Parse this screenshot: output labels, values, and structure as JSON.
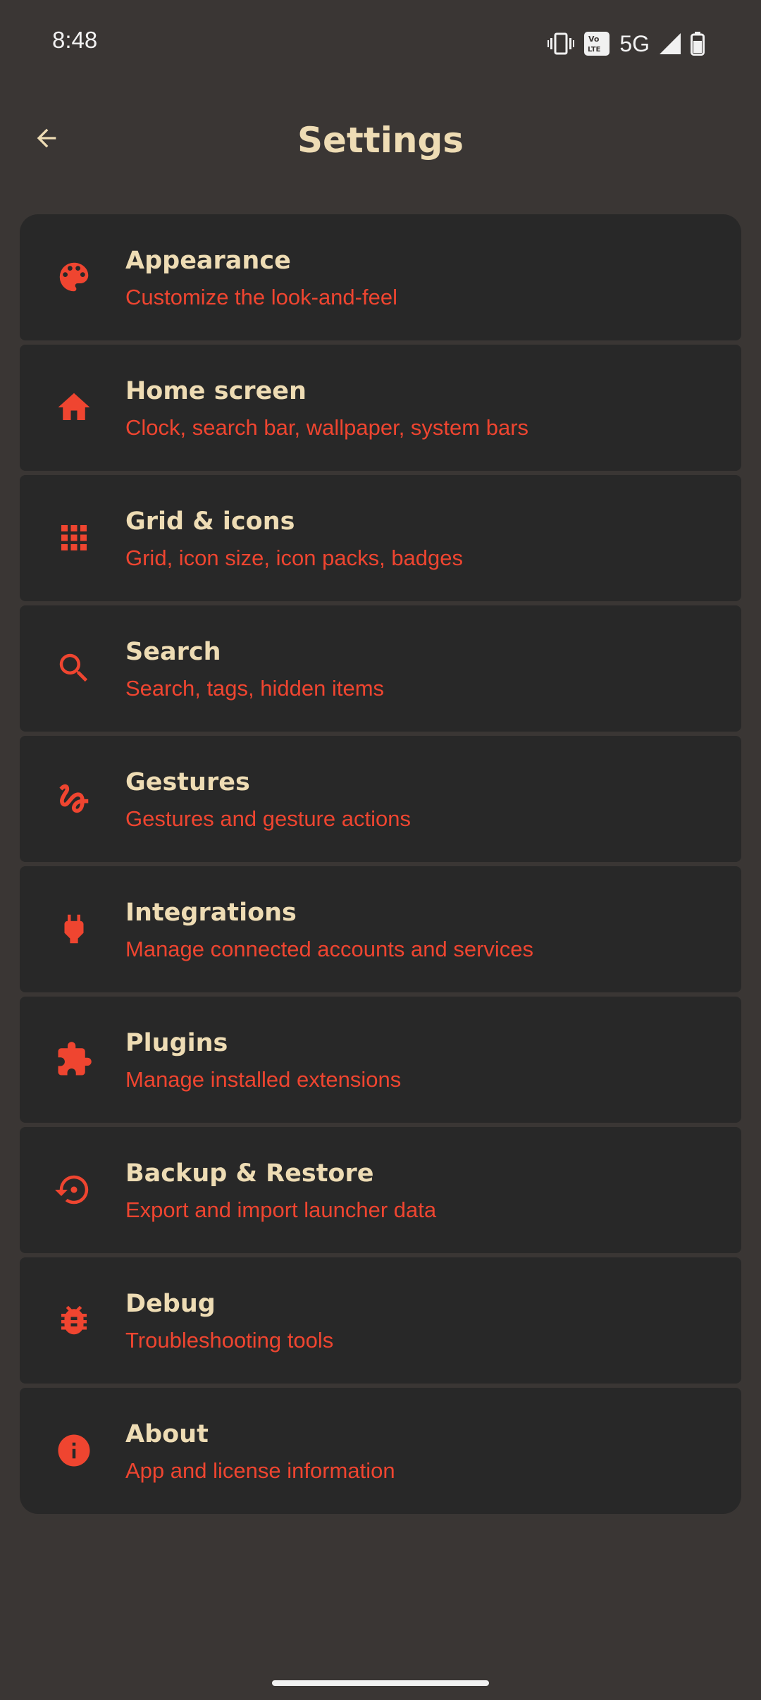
{
  "status_bar": {
    "time": "8:48",
    "network": "5G",
    "icons": [
      "vibrate-icon",
      "volte-icon",
      "signal-icon",
      "battery-icon"
    ]
  },
  "app_bar": {
    "title": "Settings",
    "back_icon": "arrow-back-icon"
  },
  "colors": {
    "background": "#3a3634",
    "card": "#282828",
    "title_text": "#eedcb4",
    "accent": "#ef4530"
  },
  "settings": [
    {
      "title": "Appearance",
      "subtitle": "Customize the look-and-feel",
      "icon": "palette-icon"
    },
    {
      "title": "Home screen",
      "subtitle": "Clock, search bar, wallpaper, system bars",
      "icon": "home-icon"
    },
    {
      "title": "Grid & icons",
      "subtitle": "Grid, icon size, icon packs, badges",
      "icon": "apps-grid-icon"
    },
    {
      "title": "Search",
      "subtitle": "Search, tags, hidden items",
      "icon": "search-icon"
    },
    {
      "title": "Gestures",
      "subtitle": "Gestures and gesture actions",
      "icon": "gesture-icon"
    },
    {
      "title": "Integrations",
      "subtitle": "Manage connected accounts and services",
      "icon": "plug-icon"
    },
    {
      "title": "Plugins",
      "subtitle": "Manage installed extensions",
      "icon": "extension-icon"
    },
    {
      "title": "Backup & Restore",
      "subtitle": "Export and import launcher data",
      "icon": "restore-icon"
    },
    {
      "title": "Debug",
      "subtitle": "Troubleshooting tools",
      "icon": "bug-icon"
    },
    {
      "title": "About",
      "subtitle": "App and license information",
      "icon": "info-icon"
    }
  ]
}
